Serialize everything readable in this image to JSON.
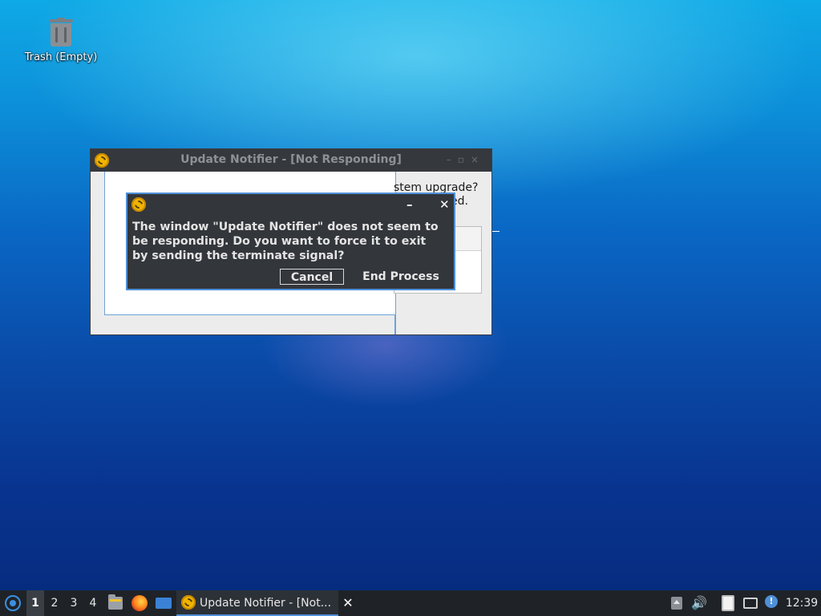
{
  "desktop": {
    "icons": [
      {
        "label": "Trash (Empty)",
        "icon": "trash-icon"
      }
    ]
  },
  "main_window": {
    "title": "Update Notifier - [Not Responding]",
    "icon": "update-notifier-icon",
    "controls": [
      "minimize",
      "maximize",
      "close"
    ],
    "partial_text_line1": "stem upgrade?",
    "partial_text_line2": "ed."
  },
  "dialog": {
    "icon": "update-notifier-icon",
    "minimize_label": "–",
    "close_label": "✕",
    "message": "The window \"Update Notifier\" does not seem to\nbe responding.  Do you want to force it to exit\nby sending the terminate signal?",
    "cancel_label": "Cancel",
    "end_process_label": "End Process"
  },
  "taskbar": {
    "workspaces": [
      "1",
      "2",
      "3",
      "4"
    ],
    "active_workspace": "1",
    "task": {
      "label": "Update Notifier - [Not...",
      "close_label": "✕"
    },
    "clock": "12:39"
  },
  "colors": {
    "accent": "#4f90d8",
    "titlebar": "#35383d",
    "dialog_bg": "#33363b",
    "taskbar_bg": "#1f2328"
  }
}
